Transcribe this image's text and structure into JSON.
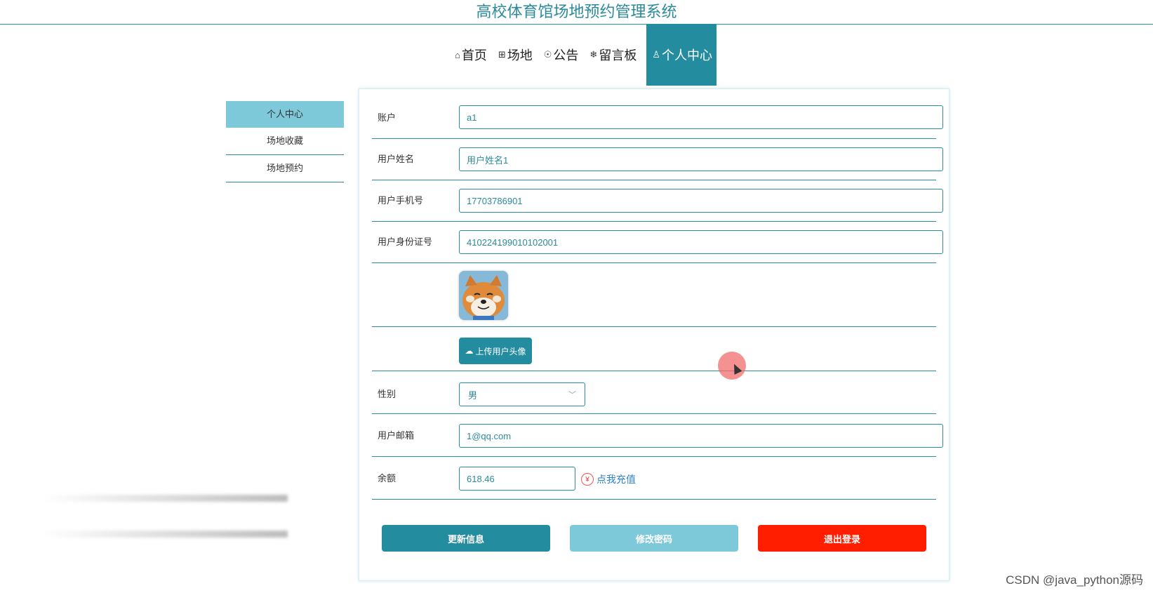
{
  "site": {
    "title": "高校体育馆场地预约管理系统"
  },
  "nav": {
    "items": [
      {
        "icon": "⌂",
        "label": "首页"
      },
      {
        "icon": "⊞",
        "label": "场地"
      },
      {
        "icon": "☉",
        "label": "公告"
      },
      {
        "icon": "❄",
        "label": "留言板"
      },
      {
        "icon": "♙",
        "label": "个人中心"
      }
    ]
  },
  "sidebar": {
    "items": [
      {
        "label": "个人中心"
      },
      {
        "label": "场地收藏"
      },
      {
        "label": "场地预约"
      }
    ]
  },
  "form": {
    "account": {
      "label": "账户",
      "value": "a1"
    },
    "name": {
      "label": "用户姓名",
      "value": "用户姓名1"
    },
    "phone": {
      "label": "用户手机号",
      "value": "17703786901"
    },
    "idcard": {
      "label": "用户身份证号",
      "value": "410224199010102001"
    },
    "upload_label": "上传用户头像",
    "gender": {
      "label": "性别",
      "value": "男"
    },
    "email": {
      "label": "用户邮箱",
      "value": "1@qq.com"
    },
    "balance": {
      "label": "余额",
      "value": "618.46",
      "recharge": "点我充值"
    }
  },
  "actions": {
    "update": "更新信息",
    "change_password": "修改密码",
    "logout": "退出登录"
  },
  "colors": {
    "primary": "#238c9f",
    "light": "#7ec9d9",
    "danger": "#ff1e00"
  },
  "watermark": "CSDN @java_python源码"
}
